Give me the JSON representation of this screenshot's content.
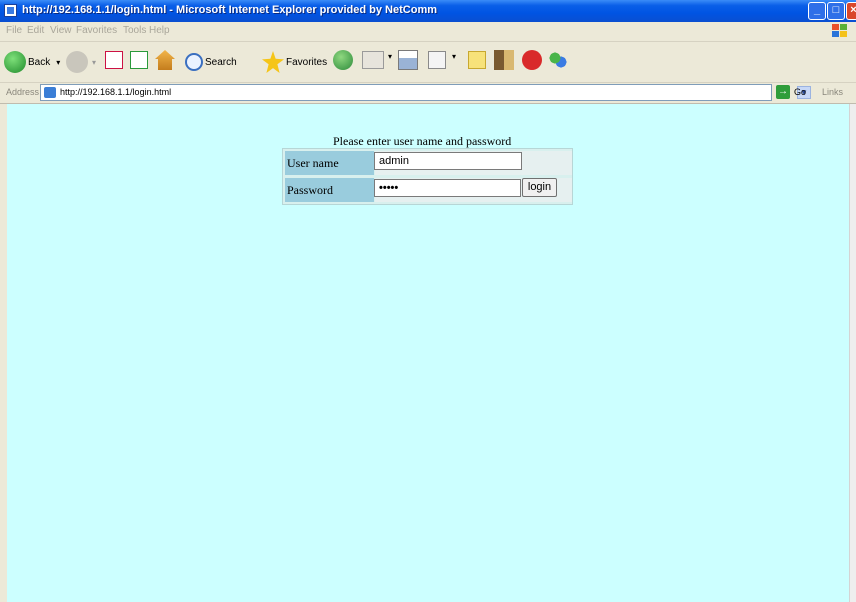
{
  "window": {
    "title": "http://192.168.1.1/login.html - Microsoft Internet Explorer provided by NetComm"
  },
  "menu": [
    "File",
    "Edit",
    "View",
    "Favorites",
    "Tools",
    "Help"
  ],
  "toolbar": {
    "back_label": "Back",
    "search_label": "Search",
    "favorites_label": "Favorites"
  },
  "address": {
    "label": "Address",
    "url": "http://192.168.1.1/login.html",
    "go_label": "Go",
    "links_label": "Links"
  },
  "page": {
    "heading": "Please enter user name and password",
    "username_label": "User name",
    "username_value": "admin",
    "password_label": "Password",
    "password_value": "•••••",
    "login_button": "login",
    "background_color": "#CCFFFF"
  }
}
